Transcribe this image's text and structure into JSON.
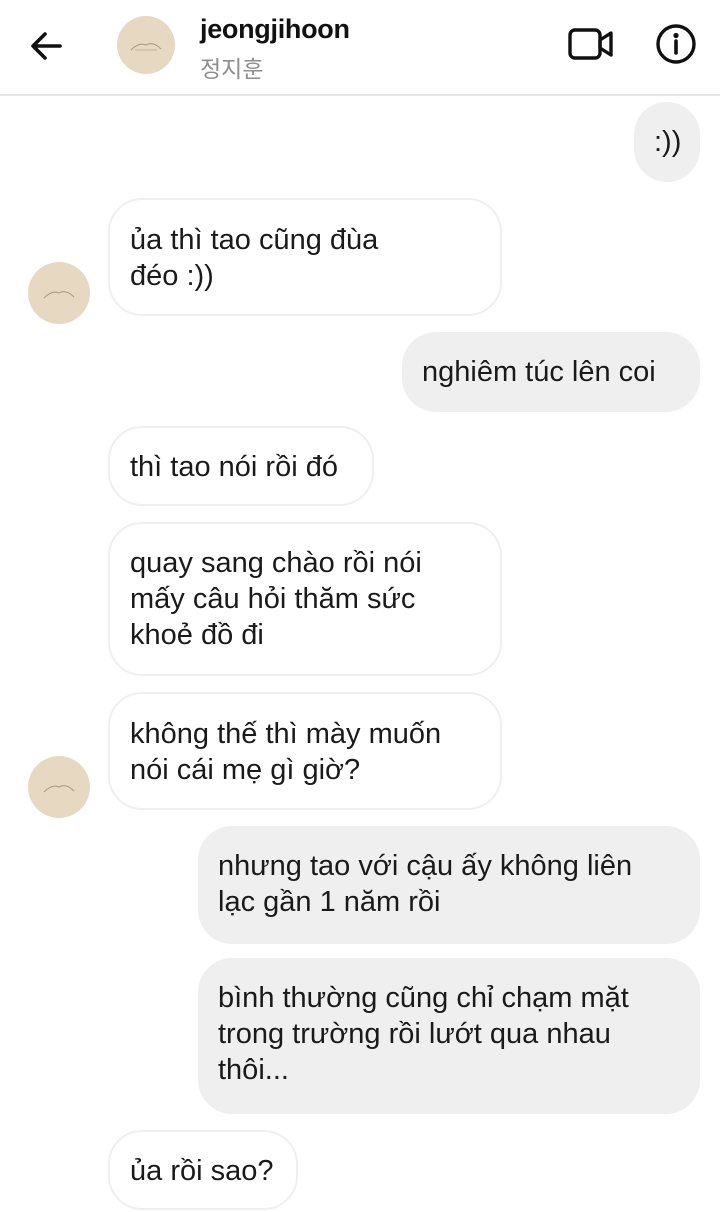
{
  "header": {
    "username": "jeongjihoon",
    "subtitle": "정지훈",
    "icons": {
      "back": "arrow-left-icon",
      "video": "video-call-icon",
      "info": "info-icon"
    }
  },
  "messages": [
    {
      "direction": "outgoing",
      "text": ":))"
    },
    {
      "direction": "incoming",
      "text": "ủa thì tao cũng đùa\nđéo :))"
    },
    {
      "direction": "outgoing",
      "text": "nghiêm túc lên coi"
    },
    {
      "direction": "incoming",
      "text": "thì tao nói rồi đó"
    },
    {
      "direction": "incoming",
      "text": "quay sang chào rồi nói\nmấy câu hỏi thăm sức\nkhoẻ đồ đi"
    },
    {
      "direction": "incoming",
      "text": "không thế thì mày muốn\nnói cái mẹ gì giờ?"
    },
    {
      "direction": "outgoing",
      "text": "nhưng tao với cậu ấy không liên\nlạc gần 1 năm rồi"
    },
    {
      "direction": "outgoing",
      "text": "bình thường cũng chỉ chạm mặt\ntrong trường rồi lướt qua nhau\nthôi..."
    },
    {
      "direction": "incoming",
      "text": "ủa rồi sao?"
    }
  ],
  "colors": {
    "outgoing_bubble": "#efefef",
    "incoming_border": "#efefef",
    "avatar_bg": "#e7d8c2",
    "text": "#1a1a1a",
    "subtitle": "#8e8e8e"
  }
}
